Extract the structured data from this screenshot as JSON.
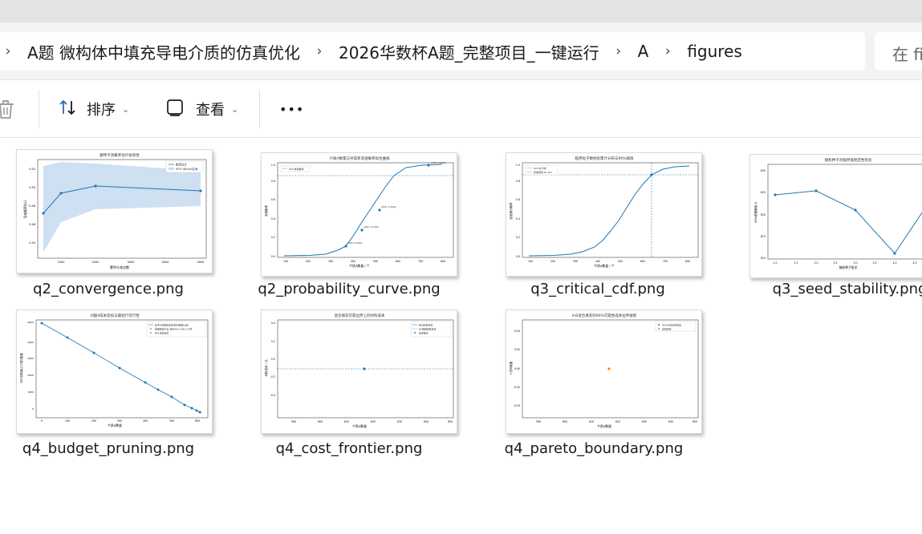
{
  "breadcrumb": {
    "items": [
      "A题 微构体中填充导电介质的仿真优化",
      "2026华数杯A题_完整项目_一键运行",
      "A",
      "figures"
    ],
    "separator_icon": "chevron-right-icon"
  },
  "search": {
    "placeholder_visible": "在 fi"
  },
  "toolbar": {
    "sort_label": "排序",
    "view_label": "查看",
    "more_label": "•••",
    "delete_icon": "trash-icon",
    "sort_icon": "sort-arrows-icon",
    "view_icon": "view-square-icon"
  },
  "files": [
    {
      "name": "q2_convergence.png"
    },
    {
      "name": "q2_probability_curve.png"
    },
    {
      "name": "q3_critical_cdf.png"
    },
    {
      "name": "q3_seed_stability.png"
    },
    {
      "name": "q4_budget_pruning.png"
    },
    {
      "name": "q4_cost_frontier.png"
    },
    {
      "name": "q4_pareto_boundary.png"
    }
  ],
  "colors": {
    "line": "#1f77b4",
    "band": "#c6dbef",
    "orange": "#ff7f0e"
  }
}
